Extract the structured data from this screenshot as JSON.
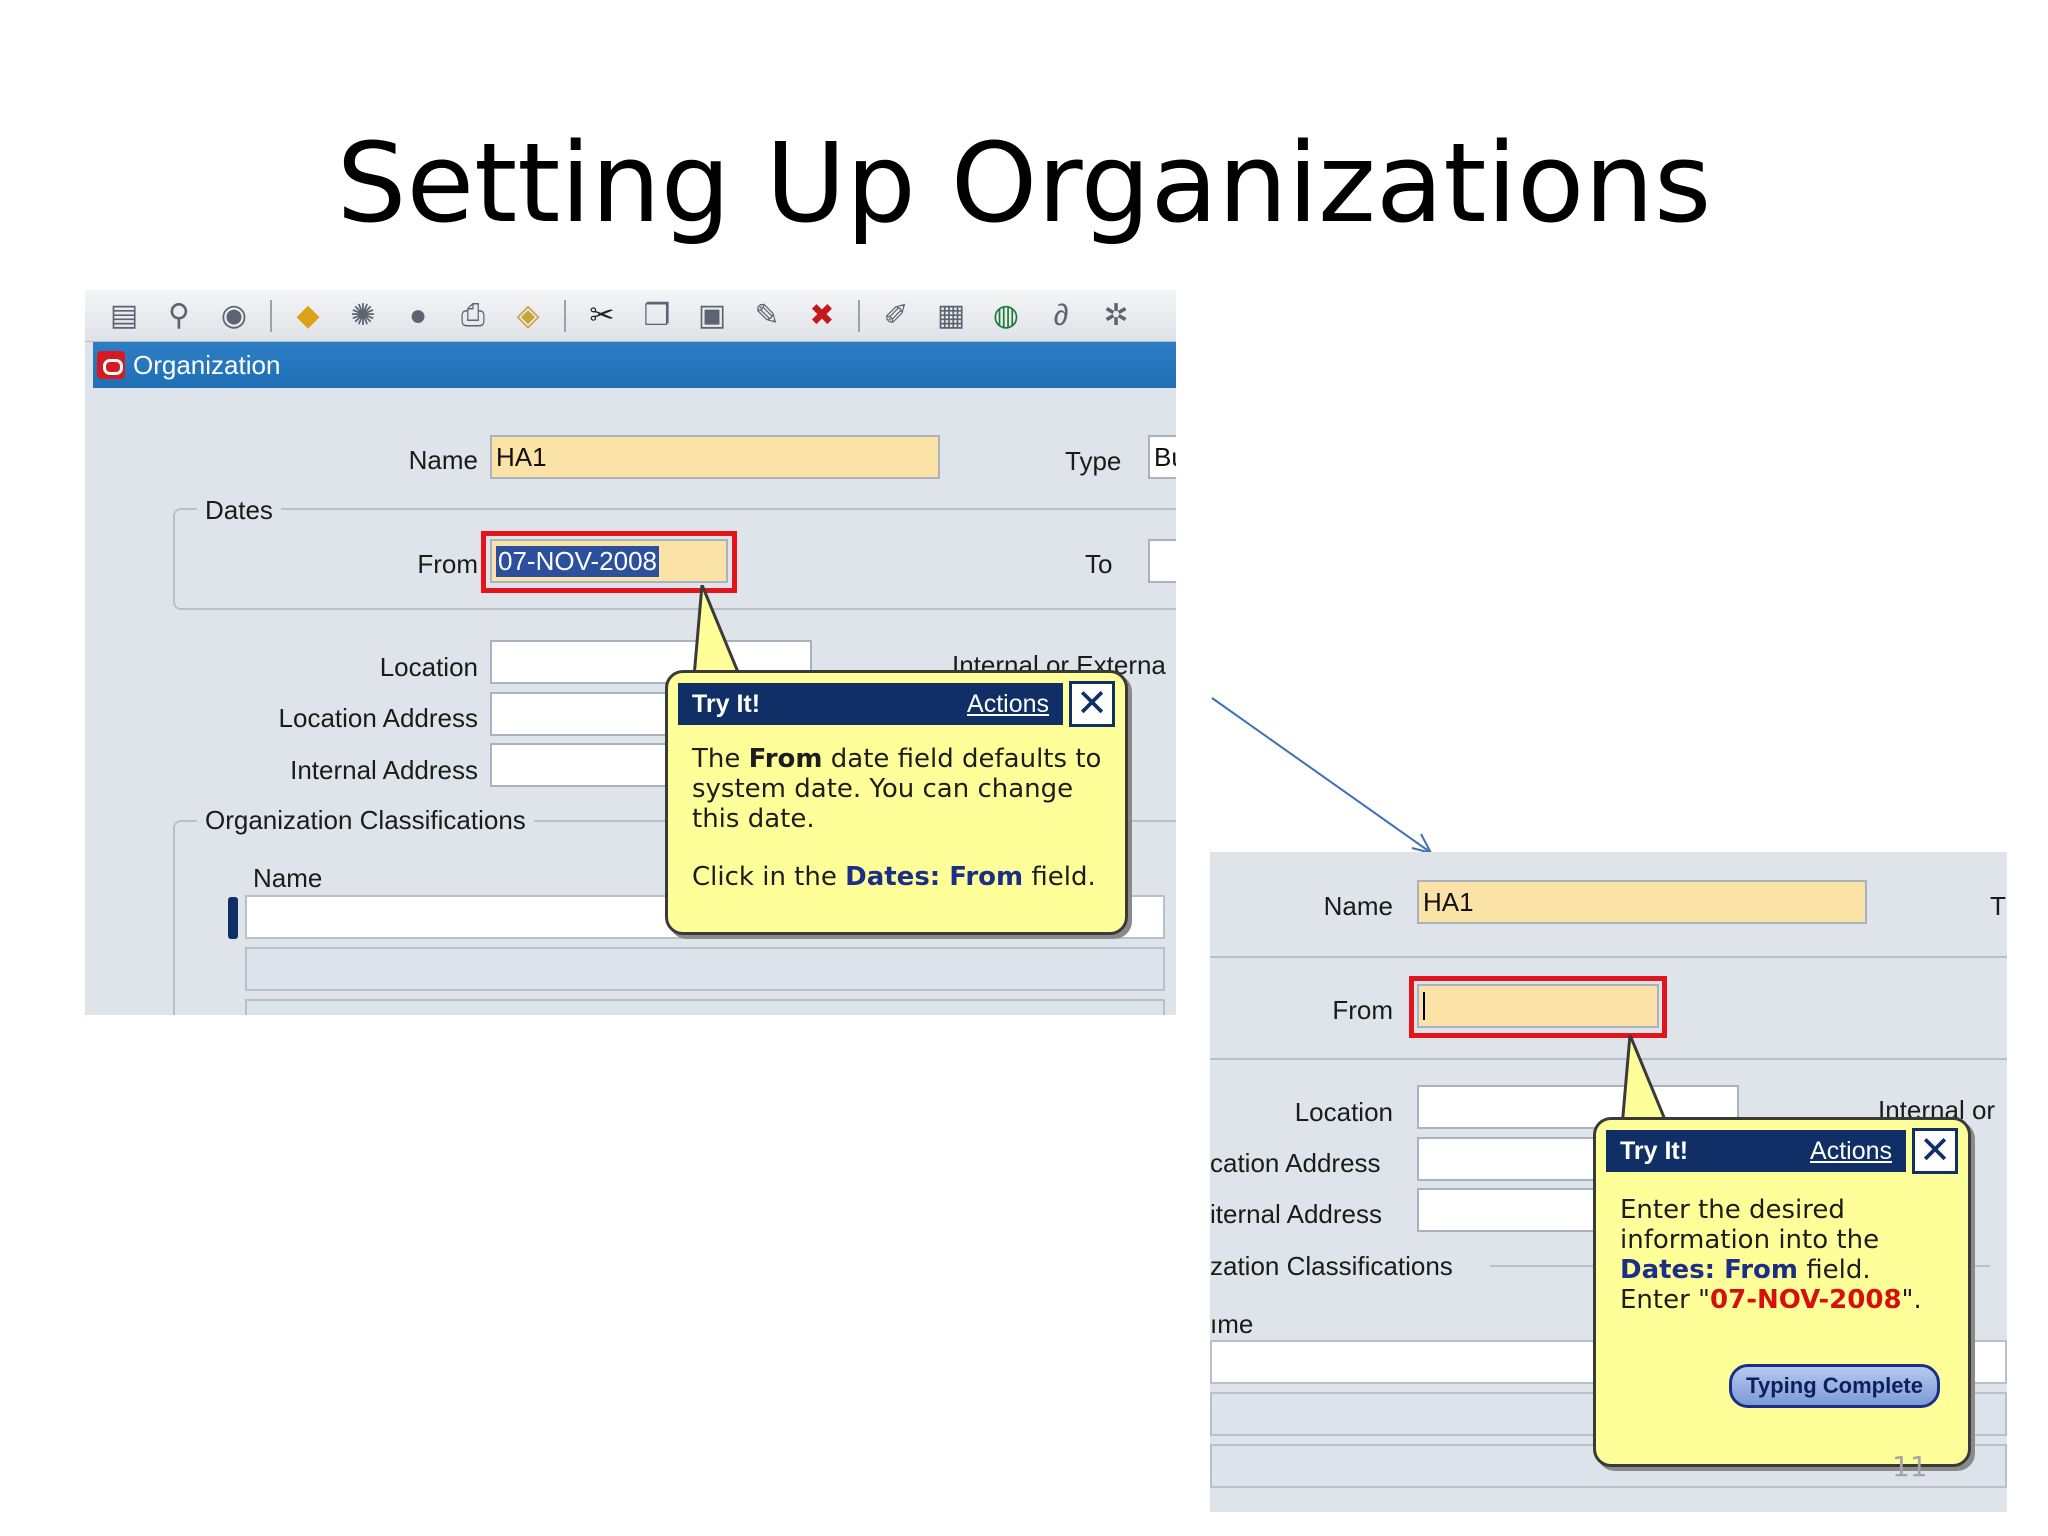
{
  "slide": {
    "title": "Setting Up Organizations",
    "page_number": "11"
  },
  "left": {
    "window_title": "Organization",
    "toolbar_icons": [
      "new-icon",
      "find-icon",
      "navigator-icon",
      "save-icon",
      "translation-icon",
      "attachments-stack-icon",
      "print-icon",
      "zoom-icon",
      "cut-icon",
      "copy-icon",
      "paste-icon",
      "edit-record-icon",
      "delete-record-icon",
      "edit-field-icon",
      "folder-icon",
      "globe-icon",
      "attachment-icon",
      "help-icon"
    ],
    "name_label": "Name",
    "name_value": "HA1",
    "type_label": "Type",
    "type_value": "Bu",
    "dates_group": "Dates",
    "from_label": "From",
    "from_value": "07-NOV-2008",
    "to_label": "To",
    "location_label": "Location",
    "location_address_label": "Location Address",
    "internal_address_label": "Internal Address",
    "internal_external_label": "Internal or Externa",
    "classifications_group": "Organization Classifications",
    "class_name_header": "Name",
    "callout": {
      "title": "Try It!",
      "actions": "Actions",
      "p1_a": "The ",
      "p1_b": "From",
      "p1_c": " date field defaults to system date. You can change this date.",
      "p2_a": "Click in the ",
      "p2_b": "Dates: From",
      "p2_c": " field."
    }
  },
  "right": {
    "name_label": "Name",
    "name_value": "HA1",
    "type_partial": "T",
    "from_label": "From",
    "from_value": "",
    "location_label": "Location",
    "location_address_label": "cation Address",
    "internal_address_label": "iternal Address",
    "internal_or_label": "Internal or",
    "classifications_label": "zation Classifications",
    "class_name_header": "ıme",
    "callout": {
      "title": "Try It!",
      "actions": "Actions",
      "line1": "Enter the desired information into the ",
      "line2": "Dates: From",
      "line3": " field.",
      "line4_a": "Enter \"",
      "line4_b": "07-NOV-2008",
      "line4_c": "\".",
      "button": "Typing Complete"
    }
  }
}
